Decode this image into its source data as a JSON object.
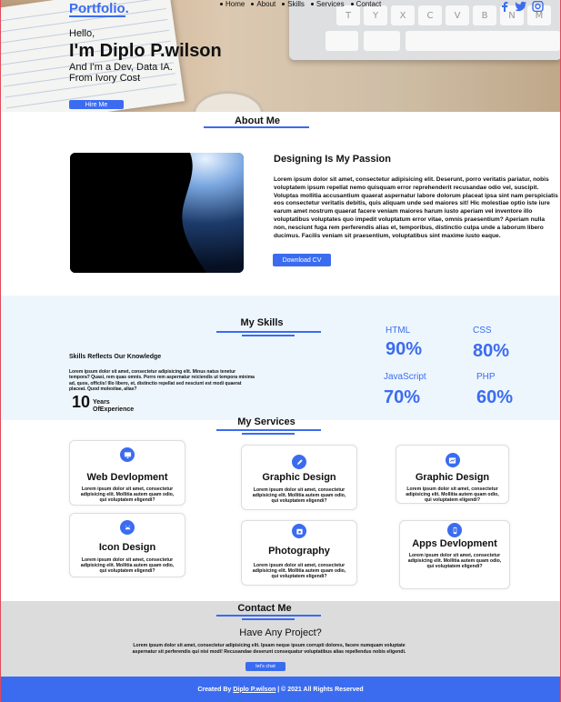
{
  "header": {
    "brand": "Portfolio.",
    "nav": [
      "Home",
      "About",
      "Skills",
      "Services",
      "Contact"
    ],
    "social_icons": [
      "facebook-icon",
      "twitter-icon",
      "instagram-icon"
    ],
    "keys_row1": [
      "T",
      "Y",
      "X",
      "C",
      "V",
      "B",
      "N",
      "M"
    ]
  },
  "hero": {
    "greeting": "Hello,",
    "name": "I'm Diplo P.wilson",
    "role": "And I'm a  Dev, Data IA.",
    "origin": "From Ivory Cost",
    "cta": "Hire Me"
  },
  "about": {
    "title": "About Me",
    "heading": "Designing Is My Passion",
    "body": "Lorem ipsum dolor sit amet, consectetur adipisicing elit. Deserunt, porro veritatis pariatur, nobis voluptatem ipsum repellat nemo quisquam error reprehenderit recusandae odio vel, suscipit. Voluptas mollitia accusantium quaerat aspernatur labore dolorum placeat ipsa sint nam perspiciatis eos consectetur veritatis debitis, quis aliquam unde sed maiores sit! Hic molestiae optio iste iure earum amet nostrum quaerat facere veniam maiores harum iusto aperiam vel inventore illo voluptatibus voluptates quo impedit voluptatum error vitae, omnis praesentium? Aperiam nulla non, nesciunt fuga rem perferendis alias et, temporibus, distinctio culpa unde a laborum libero ducimus. Facilis veniam sit praesentium, voluptatibus sint maxime iusto eaque.",
    "cta": "Download CV"
  },
  "skills": {
    "title": "My Skills",
    "subtitle": "Skills Reflects Our Knowledge",
    "body": "Lorem ipsum dolor sit amet, consectetur adipisicing elit. Minus natus tenetur tempora? Quasi, rem quas omnis. Porro rem aspernatur reiciendis ut tempora minima ad, quos, officiis! Illo libero, et, distinctio repellat sed nesciunt est modi quaerat placeat. Quod molestiae, alias?",
    "years_number": "10",
    "years_line1": "Years",
    "years_line2": "OfExperience",
    "items": [
      {
        "name": "HTML",
        "value": "90%"
      },
      {
        "name": "CSS",
        "value": "80%"
      },
      {
        "name": "JavaScript",
        "value": "70%"
      },
      {
        "name": "PHP",
        "value": "60%"
      }
    ]
  },
  "services": {
    "title": "My Services",
    "items": [
      {
        "title": "Web Devlopment",
        "icon": "monitor-icon",
        "text": "Lorem ipsum dolor sit amet, consectetur adipisicing elit. Mollitia autem quam odio, qui voluptatem eligendi?"
      },
      {
        "title": "Graphic Design",
        "icon": "pen-icon",
        "text": "Lorem ipsum dolor sit amet, consectetur adipisicing elit. Mollitia autem quam odio, qui voluptatem eligendi?"
      },
      {
        "title": "Graphic Design",
        "icon": "chart-icon",
        "text": "Lorem ipsum dolor sit amet, consectetur adipisicing elit. Mollitia autem quam odio, qui voluptatem eligendi?"
      },
      {
        "title": "Icon Design",
        "icon": "android-icon",
        "text": "Lorem ipsum dolor sit amet, consectetur adipisicing elit. Mollitia autem quam odio, qui voluptatem eligendi?"
      },
      {
        "title": "Photography",
        "icon": "camera-icon",
        "text": "Lorem ipsum dolor sit amet, consectetur adipisicing elit. Mollitia autem quam odio, qui voluptatem eligendi?"
      },
      {
        "title": "Apps Devlopment",
        "icon": "phone-icon",
        "text": "Lorem ipsum dolor sit amet, consectetur adipisicing elit. Mollitia autem quam odio, qui voluptatem eligendi?"
      }
    ]
  },
  "contact": {
    "title": "Contact Me",
    "heading": "Have Any Project?",
    "body": "Lorem ipsum dolor sit amet, consectetur adipisicing elit. Ipsam neque ipsum corrupti dolores, facere numquam voluptate aspernatur sit perferendis qui nisi modi! Recusandae deserunt consequatur voluptatibus alias repellendus nobis eligendi.",
    "cta": "let's chat"
  },
  "footer": {
    "prefix": "Created By",
    "author": "Diplo P.wilson",
    "suffix": "| © 2021 All Rights Reserved"
  },
  "colors": {
    "accent": "#3b6cf0",
    "skills_bg": "#eef6fd",
    "contact_bg": "#dcdcdc"
  }
}
